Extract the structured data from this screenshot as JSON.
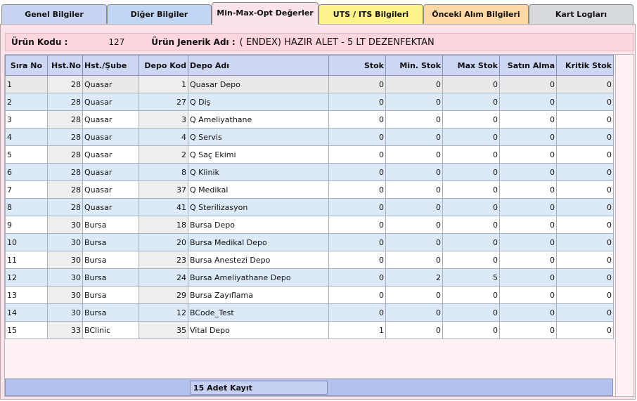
{
  "tabs": [
    {
      "label": "Genel Bilgiler",
      "bg": "#c7d3f1"
    },
    {
      "label": "Diğer Bilgiler",
      "bg": "#c0d6f4"
    },
    {
      "label": "Min-Max-Opt Değerler",
      "bg": "#fbe3ea"
    },
    {
      "label": "UTS / ITS Bilgileri",
      "bg": "#fdf38b"
    },
    {
      "label": "Önceki Alım Bilgileri",
      "bg": "#fdd8a5"
    },
    {
      "label": "Kart Logları",
      "bg": "#d6dadd"
    }
  ],
  "product": {
    "code_label": "Ürün Kodu :",
    "code_value": "127",
    "generic_label": "Ürün Jenerik Adı :",
    "generic_value": "( ENDEX) HAZIR ALET - 5 LT DEZENFEKTAN"
  },
  "columns": [
    "Sıra No",
    "Hst.No",
    "Hst./Şube",
    "Depo Kod",
    "Depo Adı",
    "Stok",
    "Min. Stok",
    "Max Stok",
    "Satın Alma",
    "Kritik Stok"
  ],
  "rows": [
    [
      "1",
      "28",
      "Quasar",
      "1",
      "Quasar Depo",
      "0",
      "0",
      "0",
      "0",
      "0"
    ],
    [
      "2",
      "28",
      "Quasar",
      "27",
      "Q Diş",
      "0",
      "0",
      "0",
      "0",
      "0"
    ],
    [
      "3",
      "28",
      "Quasar",
      "3",
      "Q Ameliyathane",
      "0",
      "0",
      "0",
      "0",
      "0"
    ],
    [
      "4",
      "28",
      "Quasar",
      "4",
      "Q Servis",
      "0",
      "0",
      "0",
      "0",
      "0"
    ],
    [
      "5",
      "28",
      "Quasar",
      "2",
      "Q Saç Ekimi",
      "0",
      "0",
      "0",
      "0",
      "0"
    ],
    [
      "6",
      "28",
      "Quasar",
      "8",
      "Q Klinik",
      "0",
      "0",
      "0",
      "0",
      "0"
    ],
    [
      "7",
      "28",
      "Quasar",
      "37",
      "Q Medikal",
      "0",
      "0",
      "0",
      "0",
      "0"
    ],
    [
      "8",
      "28",
      "Quasar",
      "41",
      "Q Sterilizasyon",
      "0",
      "0",
      "0",
      "0",
      "0"
    ],
    [
      "9",
      "30",
      "Bursa",
      "18",
      "Bursa Depo",
      "0",
      "0",
      "0",
      "0",
      "0"
    ],
    [
      "10",
      "30",
      "Bursa",
      "20",
      "Bursa Medikal Depo",
      "0",
      "0",
      "0",
      "0",
      "0"
    ],
    [
      "11",
      "30",
      "Bursa",
      "23",
      "Bursa Anestezi Depo",
      "0",
      "0",
      "0",
      "0",
      "0"
    ],
    [
      "12",
      "30",
      "Bursa",
      "24",
      "Bursa Ameliyathane Depo",
      "0",
      "2",
      "5",
      "0",
      "0"
    ],
    [
      "13",
      "30",
      "Bursa",
      "29",
      "Bursa Zayıflama",
      "0",
      "0",
      "0",
      "0",
      "0"
    ],
    [
      "14",
      "30",
      "Bursa",
      "12",
      "BCode_Test",
      "0",
      "0",
      "0",
      "0",
      "0"
    ],
    [
      "15",
      "33",
      "BClinic",
      "35",
      "Vital Depo",
      "1",
      "0",
      "0",
      "0",
      "0"
    ]
  ],
  "footer": {
    "record_count": "15 Adet Kayıt"
  }
}
